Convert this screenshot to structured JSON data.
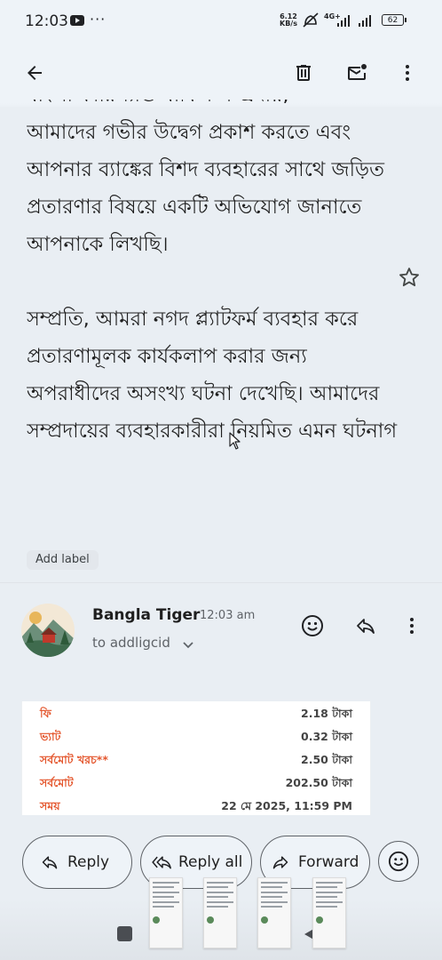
{
  "status_bar": {
    "time": "12:03",
    "net_speed": "6.12",
    "net_speed_unit": "KB/s",
    "network_type": "4G+",
    "battery": "62"
  },
  "email": {
    "partial_top_line": "বাংলা কারিগ্যান্ড বাকিস সম্প্রদায়,",
    "paragraph_1": "আমাদের গভীর উদ্বেগ প্রকাশ করতে এবং আপনার ব্যাঙ্কের বিশদ ব্যবহারের সাথে জড়িত প্রতারণার বিষয়ে একটি অভিযোগ জানাতে আপনাকে লিখছি।",
    "paragraph_2": "সম্প্রতি, আমরা নগদ প্ল্যাটফর্ম ব্যবহার করে প্রতারণামূলক কার্যকলাপ করার জন্য অপরাধীদের অসংখ্য ঘটনা দেখেছি। আমাদের সম্প্রদায়ের ব্যবহারকারীরা নিয়মিত এমন ঘটনাগ",
    "add_label": "Add label"
  },
  "message_header": {
    "sender": "Bangla Tiger",
    "time": "12:03 am",
    "recipient": "to addligcid"
  },
  "receipt": {
    "rows": [
      {
        "label": "ফি",
        "value": "2.18 টাকা"
      },
      {
        "label": "ভ্যাট",
        "value": "0.32 টাকা"
      },
      {
        "label": "সর্বমোট খরচ**",
        "value": "2.50 টাকা"
      },
      {
        "label": "সর্বমোট",
        "value": "202.50 টাকা"
      },
      {
        "label": "সময়",
        "value": "22 মে 2025, 11:59 PM"
      }
    ]
  },
  "actions": {
    "reply": "Reply",
    "reply_all": "Reply all",
    "forward": "Forward"
  },
  "colors": {
    "receipt_label": "#e4572e",
    "background": "#eef3f8"
  },
  "icons": [
    "back-arrow-icon",
    "delete-icon",
    "mark-unread-icon",
    "more-vert-icon",
    "star-icon",
    "emoji-icon",
    "reply-icon",
    "reply-all-icon",
    "forward-icon",
    "chevron-down-icon"
  ]
}
